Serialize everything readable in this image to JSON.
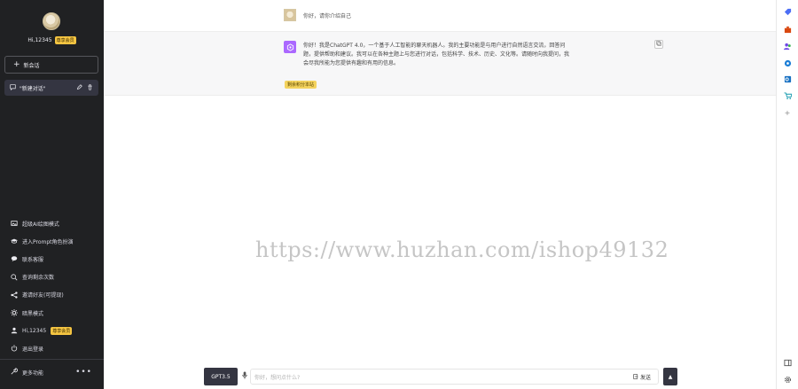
{
  "sidebar": {
    "user_name": "Hi,12345",
    "vip_label": "尊享会员",
    "new_chat_label": "新会话",
    "conversations": [
      {
        "title": "\"新建对话\""
      }
    ],
    "menu": [
      {
        "label": "超级AI绘图模式",
        "icon": "image-icon"
      },
      {
        "label": "进入Prompt角色扮演",
        "icon": "graduation-cap-icon"
      },
      {
        "label": "联系客服",
        "icon": "chat-bubble-icon"
      },
      {
        "label": "查询剩余次数",
        "icon": "search-icon"
      },
      {
        "label": "邀请好友(可提现)",
        "icon": "share-icon"
      },
      {
        "label": "暗黑模式",
        "icon": "sun-icon"
      },
      {
        "label": "Hi,12345",
        "icon": "user-icon",
        "badge": "尊享会员"
      },
      {
        "label": "退出登录",
        "icon": "power-icon"
      }
    ],
    "more_label": "更多功能"
  },
  "chat": {
    "user_message": "你好，请你介绍自己",
    "bot_message": "你好！我是ChatGPT 4.0，一个基于人工智能的聊天机器人。我的主要功能是与用户进行自然语言交流，回答问题，提供帮助和建议。我可以在各种主题上与您进行对话，包括科学、技术、历史、文化等。请随时向我提问，我会尽我所能为您提供有趣和有用的信息。",
    "bot_tag": "剩余积分本站"
  },
  "watermark": "https://www.huzhan.com/ishop49132",
  "input": {
    "model_label": "GPT3.5",
    "placeholder": "你好，想问点什么?",
    "send_label": "发送"
  },
  "colors": {
    "sidebar_bg": "#202123",
    "accent_bot": "#ab68ff",
    "vip_badge": "#f5c542"
  }
}
